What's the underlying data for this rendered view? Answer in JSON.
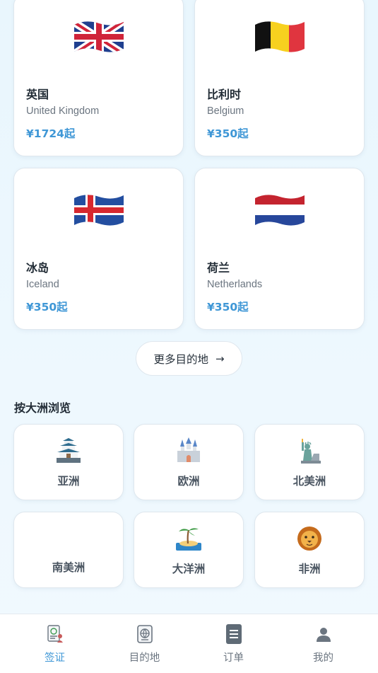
{
  "countries": [
    {
      "cn": "英国",
      "en": "United Kingdom",
      "price": "¥1724起",
      "flag": "uk-flag-icon"
    },
    {
      "cn": "比利时",
      "en": "Belgium",
      "price": "¥350起",
      "flag": "belgium-flag-icon"
    },
    {
      "cn": "冰岛",
      "en": "Iceland",
      "price": "¥350起",
      "flag": "iceland-flag-icon"
    },
    {
      "cn": "荷兰",
      "en": "Netherlands",
      "price": "¥350起",
      "flag": "netherlands-flag-icon"
    }
  ],
  "more_button": {
    "label": "更多目的地",
    "arrow": "→"
  },
  "continents_section": {
    "title": "按大洲浏览",
    "items": [
      {
        "label": "亚洲",
        "icon": "japanese-castle-icon"
      },
      {
        "label": "欧洲",
        "icon": "castle-icon"
      },
      {
        "label": "北美洲",
        "icon": "statue-of-liberty-icon"
      },
      {
        "label": "南美洲",
        "icon": ""
      },
      {
        "label": "大洋洲",
        "icon": "desert-island-icon"
      },
      {
        "label": "非洲",
        "icon": "lion-icon"
      }
    ]
  },
  "tabbar": {
    "items": [
      {
        "label": "签证",
        "icon": "passport-icon",
        "active": true
      },
      {
        "label": "目的地",
        "icon": "globe-passport-icon",
        "active": false
      },
      {
        "label": "订单",
        "icon": "document-icon",
        "active": false
      },
      {
        "label": "我的",
        "icon": "user-icon",
        "active": false
      }
    ]
  },
  "colors": {
    "accent": "#3f97d6",
    "background": "#eaf6fd",
    "card": "#ffffff"
  }
}
